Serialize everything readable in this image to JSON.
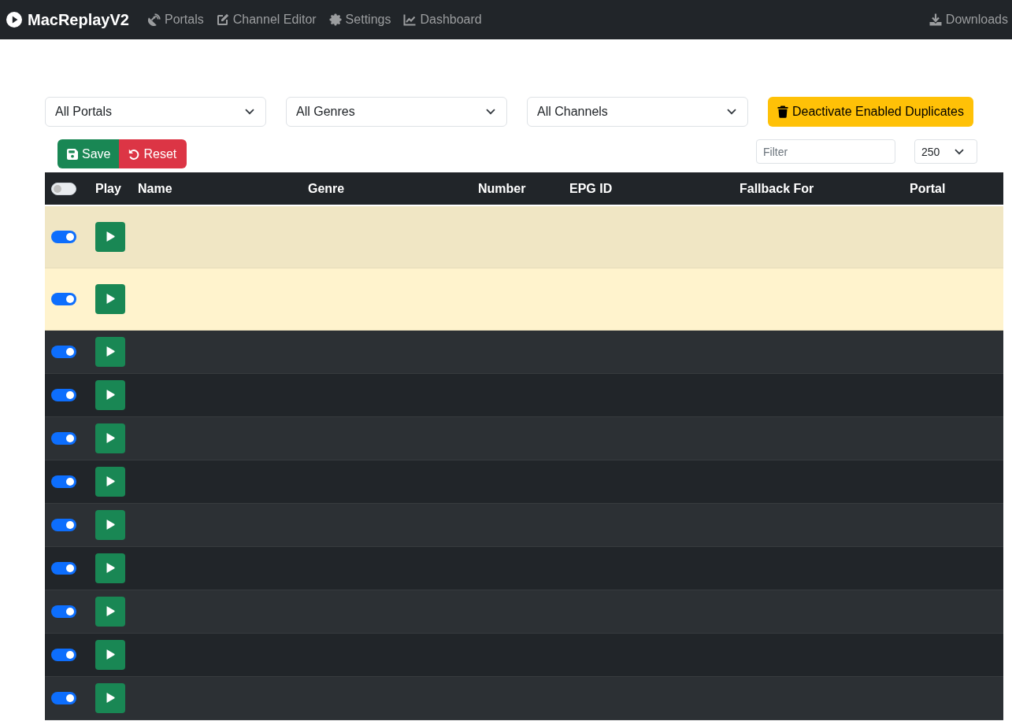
{
  "navbar": {
    "brand": "MacReplayV2",
    "links": [
      {
        "label": "Portals"
      },
      {
        "label": "Channel Editor"
      },
      {
        "label": "Settings"
      },
      {
        "label": "Dashboard"
      }
    ],
    "right_link": {
      "label": "Downloads"
    }
  },
  "filters": [
    {
      "value": "All Portals"
    },
    {
      "value": "All Genres"
    },
    {
      "value": "All Channels"
    }
  ],
  "deactivate_button": "Deactivate Enabled Duplicates",
  "actions": {
    "save_button": "Save",
    "reset_button": "Reset"
  },
  "filter_field": {
    "placeholder": "Filter"
  },
  "page_size": "250",
  "table": {
    "select_all": {
      "on": false
    },
    "columns": [
      "Play",
      "Name",
      "Genre",
      "Number",
      "EPG ID",
      "Fallback For",
      "Portal"
    ],
    "rows": [
      {
        "enabled": true,
        "duplicate": true
      },
      {
        "enabled": true,
        "duplicate": true
      },
      {
        "enabled": true,
        "duplicate": false
      },
      {
        "enabled": true,
        "duplicate": false
      },
      {
        "enabled": true,
        "duplicate": false
      },
      {
        "enabled": true,
        "duplicate": false
      },
      {
        "enabled": true,
        "duplicate": false
      },
      {
        "enabled": true,
        "duplicate": false
      },
      {
        "enabled": true,
        "duplicate": false
      },
      {
        "enabled": true,
        "duplicate": false
      },
      {
        "enabled": true,
        "duplicate": false
      }
    ]
  }
}
